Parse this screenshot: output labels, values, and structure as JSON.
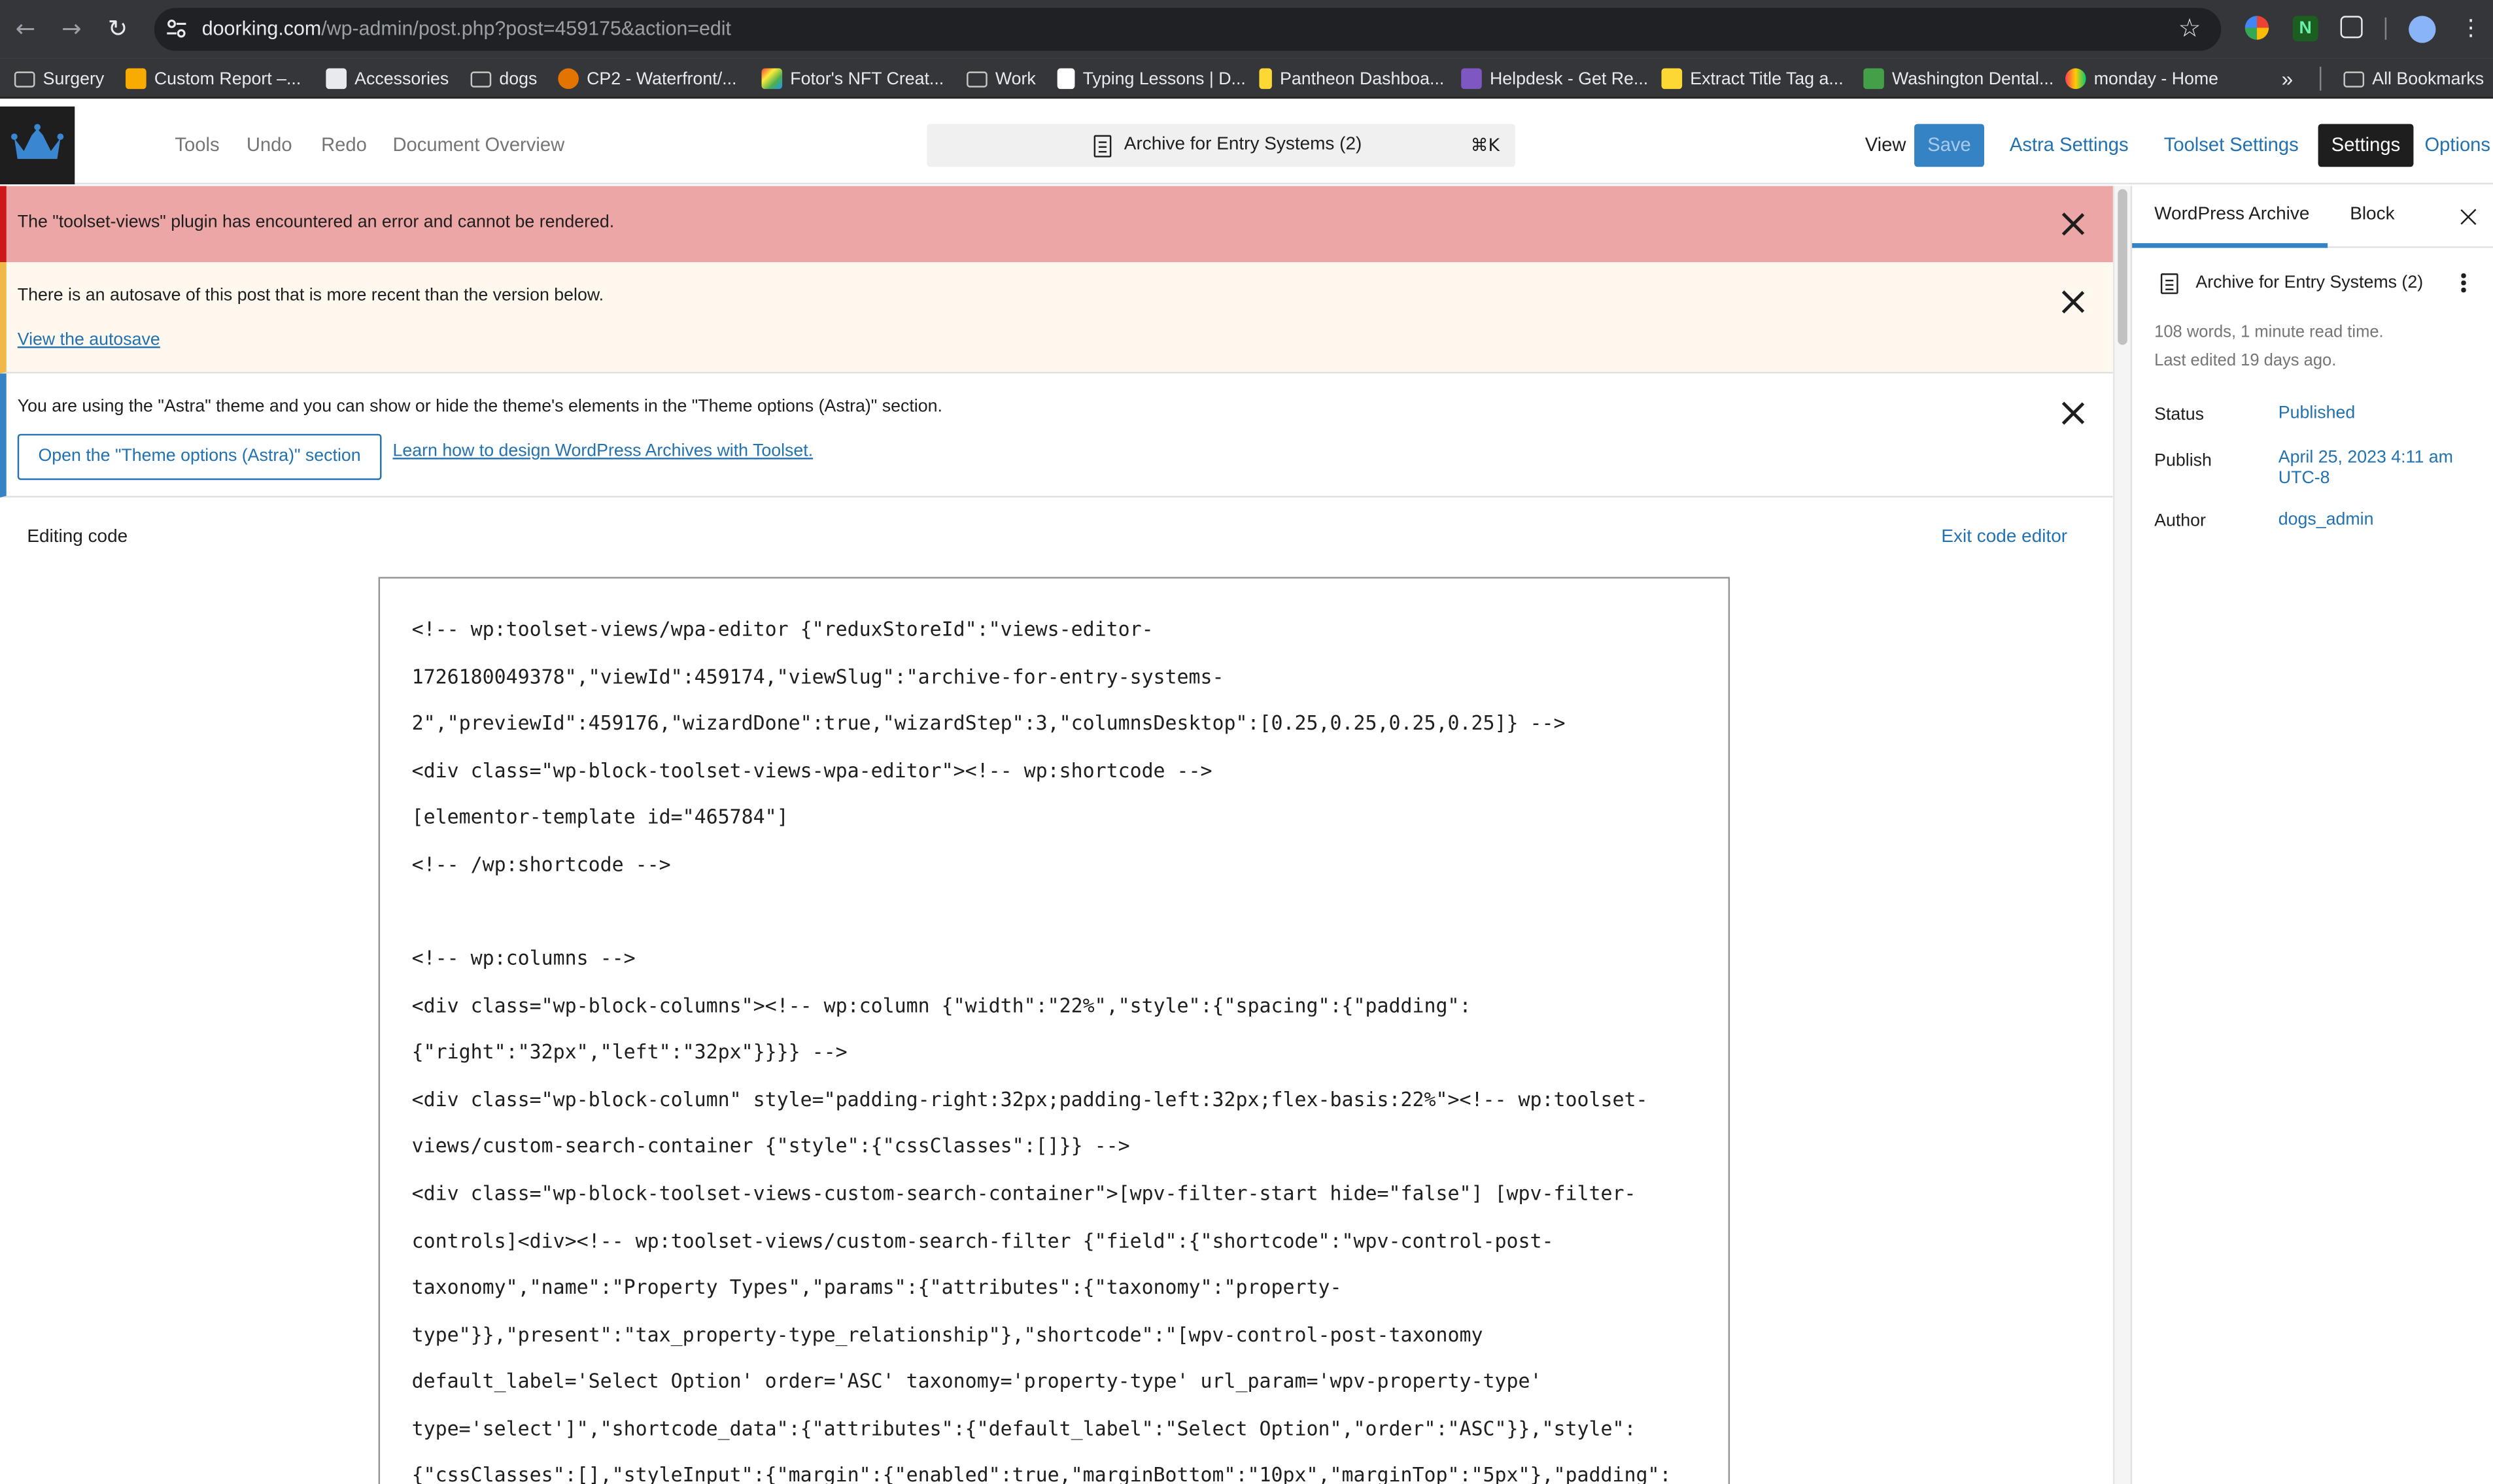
{
  "browser": {
    "url_host": "doorking.com",
    "url_path": "/wp-admin/post.php?post=459175&action=edit",
    "bookmarks": [
      "Surgery",
      "Custom Report –...",
      "Accessories",
      "dogs",
      "CP2 - Waterfront/...",
      "Fotor's NFT Creat...",
      "Work",
      "Typing Lessons | D...",
      "Pantheon Dashboa...",
      "Helpdesk - Get Re...",
      "Extract Title Tag a...",
      "Washington Dental...",
      "monday - Home"
    ],
    "bookmarks_overflow": "»",
    "all_bookmarks": "All Bookmarks"
  },
  "toolbar": {
    "tools": "Tools",
    "undo": "Undo",
    "redo": "Redo",
    "document_overview": "Document Overview",
    "doc_title": "Archive for Entry Systems (2)",
    "shortcut": "⌘K",
    "view": "View",
    "save": "Save",
    "astra_settings": "Astra Settings",
    "toolset_settings": "Toolset Settings",
    "settings": "Settings",
    "options": "Options"
  },
  "notices": {
    "error": "The \"toolset-views\" plugin has encountered an error and cannot be rendered.",
    "autosave": "There is an autosave of this post that is more recent than the version below.",
    "autosave_link": "View the autosave",
    "astra": "You are using the \"Astra\" theme and you can show or hide the theme's elements in the \"Theme options (Astra)\" section.",
    "astra_button": "Open the \"Theme options (Astra)\" section",
    "astra_link": "Learn how to design WordPress Archives with Toolset."
  },
  "editor": {
    "editing_label": "Editing code",
    "exit_label": "Exit code editor",
    "code_lines": [
      "<!-- wp:toolset-views/wpa-editor {\"reduxStoreId\":\"views-editor-",
      "1726180049378\",\"viewId\":459174,\"viewSlug\":\"archive-for-entry-systems-",
      "2\",\"previewId\":459176,\"wizardDone\":true,\"wizardStep\":3,\"columnsDesktop\":[0.25,0.25,0.25,0.25]} -->",
      "<div class=\"wp-block-toolset-views-wpa-editor\"><!-- wp:shortcode -->",
      "[elementor-template id=\"465784\"]",
      "<!-- /wp:shortcode -->",
      "",
      "<!-- wp:columns -->",
      "<div class=\"wp-block-columns\"><!-- wp:column {\"width\":\"22%\",\"style\":{\"spacing\":{\"padding\":",
      "{\"right\":\"32px\",\"left\":\"32px\"}}}} -->",
      "<div class=\"wp-block-column\" style=\"padding-right:32px;padding-left:32px;flex-basis:22%\"><!-- wp:toolset-",
      "views/custom-search-container {\"style\":{\"cssClasses\":[]}} -->",
      "<div class=\"wp-block-toolset-views-custom-search-container\">[wpv-filter-start hide=\"false\"] [wpv-filter-",
      "controls]<div><!-- wp:toolset-views/custom-search-filter {\"field\":{\"shortcode\":\"wpv-control-post-",
      "taxonomy\",\"name\":\"Property Types\",\"params\":{\"attributes\":{\"taxonomy\":\"property-",
      "type\"}},\"present\":\"tax_property-type_relationship\"},\"shortcode\":\"[wpv-control-post-taxonomy",
      "default_label='Select Option' order='ASC' taxonomy='property-type' url_param='wpv-property-type'",
      "type='select']\",\"shortcode_data\":{\"attributes\":{\"default_label\":\"Select Option\",\"order\":\"ASC\"}},\"style\":",
      "{\"cssClasses\":[],\"styleInput\":{\"margin\":{\"enabled\":true,\"marginBottom\":\"10px\",\"marginTop\":\"5px\"},\"padding\":"
    ]
  },
  "sidebar": {
    "tab_archive": "WordPress Archive",
    "tab_block": "Block",
    "doc_title": "Archive for Entry Systems (2)",
    "read_time": "108 words, 1 minute read time.",
    "last_edited": "Last edited 19 days ago.",
    "status_label": "Status",
    "status_value": "Published",
    "publish_label": "Publish",
    "publish_value_1": "April 25, 2023 4:11 am",
    "publish_value_2": "UTC-8",
    "author_label": "Author",
    "author_value": "dogs_admin"
  },
  "colors": {
    "accent": "#2271b1",
    "error_bg": "#eda6a6",
    "warning_bg": "#fef8ee",
    "chrome_dark": "#35363a"
  }
}
